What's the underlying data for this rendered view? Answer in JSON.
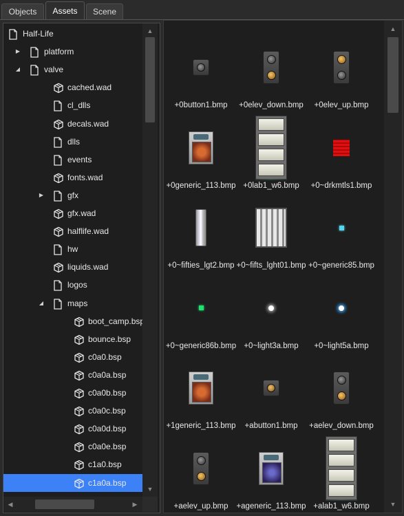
{
  "tabs": [
    {
      "label": "Objects",
      "active": false
    },
    {
      "label": "Assets",
      "active": true
    },
    {
      "label": "Scene",
      "active": false
    }
  ],
  "tree": [
    {
      "label": "Half-Life",
      "icon": "document-icon",
      "arrow": "",
      "depth": 0
    },
    {
      "label": "platform",
      "icon": "document-icon",
      "arrow": "collapsed",
      "depth": 1
    },
    {
      "label": "valve",
      "icon": "document-icon",
      "arrow": "expanded",
      "depth": 1
    },
    {
      "label": "cached.wad",
      "icon": "package-icon",
      "arrow": "",
      "depth": 2
    },
    {
      "label": "cl_dlls",
      "icon": "document-icon",
      "arrow": "",
      "depth": 2
    },
    {
      "label": "decals.wad",
      "icon": "package-icon",
      "arrow": "",
      "depth": 2
    },
    {
      "label": "dlls",
      "icon": "document-icon",
      "arrow": "",
      "depth": 2
    },
    {
      "label": "events",
      "icon": "document-icon",
      "arrow": "",
      "depth": 2
    },
    {
      "label": "fonts.wad",
      "icon": "package-icon",
      "arrow": "",
      "depth": 2
    },
    {
      "label": "gfx",
      "icon": "document-icon",
      "arrow": "collapsed",
      "depth": 2
    },
    {
      "label": "gfx.wad",
      "icon": "package-icon",
      "arrow": "",
      "depth": 2
    },
    {
      "label": "halflife.wad",
      "icon": "package-icon",
      "arrow": "",
      "depth": 2
    },
    {
      "label": "hw",
      "icon": "document-icon",
      "arrow": "",
      "depth": 2
    },
    {
      "label": "liquids.wad",
      "icon": "package-icon",
      "arrow": "",
      "depth": 2
    },
    {
      "label": "logos",
      "icon": "document-icon",
      "arrow": "",
      "depth": 2
    },
    {
      "label": "maps",
      "icon": "document-icon",
      "arrow": "expanded",
      "depth": 2
    },
    {
      "label": "boot_camp.bsp",
      "icon": "package-icon",
      "arrow": "",
      "depth": 3
    },
    {
      "label": "bounce.bsp",
      "icon": "package-icon",
      "arrow": "",
      "depth": 3
    },
    {
      "label": "c0a0.bsp",
      "icon": "package-icon",
      "arrow": "",
      "depth": 3
    },
    {
      "label": "c0a0a.bsp",
      "icon": "package-icon",
      "arrow": "",
      "depth": 3
    },
    {
      "label": "c0a0b.bsp",
      "icon": "package-icon",
      "arrow": "",
      "depth": 3
    },
    {
      "label": "c0a0c.bsp",
      "icon": "package-icon",
      "arrow": "",
      "depth": 3
    },
    {
      "label": "c0a0d.bsp",
      "icon": "package-icon",
      "arrow": "",
      "depth": 3
    },
    {
      "label": "c0a0e.bsp",
      "icon": "package-icon",
      "arrow": "",
      "depth": 3
    },
    {
      "label": "c1a0.bsp",
      "icon": "package-icon",
      "arrow": "",
      "depth": 3
    },
    {
      "label": "c1a0a.bsp",
      "icon": "package-icon",
      "arrow": "",
      "depth": 3,
      "selected": true
    }
  ],
  "assets": [
    {
      "name": "+0button1.bmp",
      "preview": "button"
    },
    {
      "name": "+0elev_down.bmp",
      "preview": "elev-down"
    },
    {
      "name": "+0elev_up.bmp",
      "preview": "elev-up"
    },
    {
      "name": "+0generic_113.bmp",
      "preview": "generic"
    },
    {
      "name": "+0lab1_w6.bmp",
      "preview": "lab"
    },
    {
      "name": "+0~drkmtls1.bmp",
      "preview": "red"
    },
    {
      "name": "+0~fifties_lgt2.bmp",
      "preview": "tube"
    },
    {
      "name": "+0~fifts_lght01.bmp",
      "preview": "fifts"
    },
    {
      "name": "+0~generic85.bmp",
      "preview": "cyan-dot"
    },
    {
      "name": "+0~generic86b.bmp",
      "preview": "green-dot"
    },
    {
      "name": "+0~light3a.bmp",
      "preview": "star"
    },
    {
      "name": "+0~light5a.bmp",
      "preview": "blue-star"
    },
    {
      "name": "+1generic_113.bmp",
      "preview": "generic"
    },
    {
      "name": "+abutton1.bmp",
      "preview": "button-orange"
    },
    {
      "name": "+aelev_down.bmp",
      "preview": "elev-down"
    },
    {
      "name": "+aelev_up.bmp",
      "preview": "elev-down"
    },
    {
      "name": "+ageneric_113.bmp",
      "preview": "generic-purple"
    },
    {
      "name": "+alab1_w6.bmp",
      "preview": "lab"
    }
  ],
  "colors": {
    "selection": "#3c82f6",
    "panel_bg": "#1e1e1e",
    "window_bg": "#2b2b2b"
  }
}
